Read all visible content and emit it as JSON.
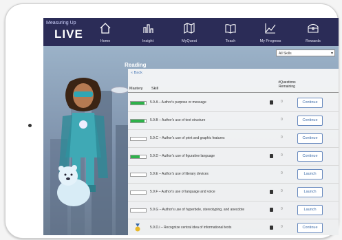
{
  "app": {
    "logo_small": "Measuring Up",
    "logo_big": "LIVE"
  },
  "nav": [
    {
      "label": "Home",
      "icon": "home-icon"
    },
    {
      "label": "Insight",
      "icon": "chart-icon"
    },
    {
      "label": "MyQuest",
      "icon": "map-icon"
    },
    {
      "label": "Teach",
      "icon": "book-icon"
    },
    {
      "label": "My Progress",
      "icon": "progress-chart-icon"
    },
    {
      "label": "Rewards",
      "icon": "treasure-chest-icon"
    }
  ],
  "filter": {
    "selected": "All Skills"
  },
  "panel": {
    "title": "Reading",
    "back": "« Back",
    "col_mastery": "Mastery",
    "col_skill": "Skill",
    "col_questions": "#Questions Remaining"
  },
  "rows": [
    {
      "skill": "5.9.A – Author's purpose or message",
      "mastery": 0.9,
      "book": true,
      "count": "0",
      "action": "Continue",
      "medal": false
    },
    {
      "skill": "5.9.B – Author's use of text structure",
      "mastery": 0.9,
      "book": false,
      "count": "0",
      "action": "Continue",
      "medal": false
    },
    {
      "skill": "5.9.C – Author's use of print and graphic features",
      "mastery": 0.0,
      "book": false,
      "count": "0",
      "action": "Continue",
      "medal": false
    },
    {
      "skill": "5.9.D – Author's use of figurative language",
      "mastery": 0.6,
      "book": true,
      "count": "0",
      "action": "Continue",
      "medal": false
    },
    {
      "skill": "5.9.E – Author's use of literary devices",
      "mastery": 0.0,
      "book": false,
      "count": "0",
      "action": "Launch",
      "medal": false
    },
    {
      "skill": "5.9.F – Author's use of language and voice",
      "mastery": 0.0,
      "book": true,
      "count": "0",
      "action": "Launch",
      "medal": false
    },
    {
      "skill": "5.9.G – Author's use of hyperbole, stereotyping, and anecdote",
      "mastery": 0.0,
      "book": true,
      "count": "0",
      "action": "Launch",
      "medal": false
    },
    {
      "skill": "5.9.D.i – Recognize central idea of informational texts",
      "mastery": 1.0,
      "book": true,
      "count": "0",
      "action": "Continue",
      "medal": true
    }
  ],
  "colors": {
    "nav_bg": "#2b2c57",
    "mastery_green": "#2db24a",
    "button_blue": "#3a6aa8"
  }
}
